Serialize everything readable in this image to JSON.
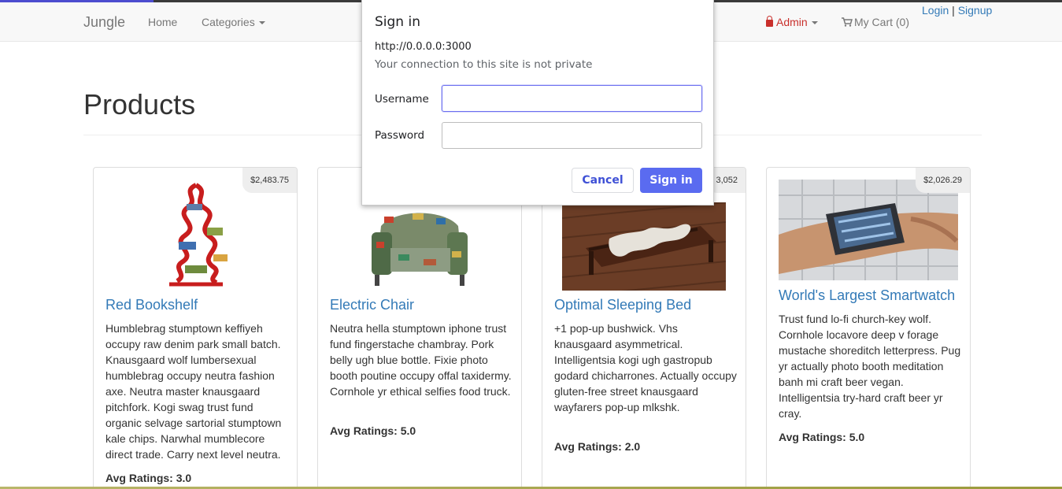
{
  "navbar": {
    "brand": "Jungle",
    "home": "Home",
    "categories": "Categories",
    "admin": "Admin",
    "cart": "My Cart (0)",
    "login": "Login",
    "separator": "|",
    "signup": "Signup"
  },
  "page": {
    "title": "Products"
  },
  "products": [
    {
      "name": "Red Bookshelf",
      "price": "$2,483.75",
      "description": "Humblebrag stumptown keffiyeh occupy raw denim park small batch. Knausgaard wolf lumbersexual humblebrag occupy neutra fashion axe. Neutra master knausgaard pitchfork. Kogi swag trust fund organic selvage sartorial stumptown kale chips. Narwhal mumblecore direct trade. Carry next level neutra.",
      "ratings_label": "Avg Ratings:",
      "rating": "3.0"
    },
    {
      "name": "Electric Chair",
      "price": "",
      "description": "Neutra hella stumptown iphone trust fund fingerstache chambray. Pork belly ugh blue bottle. Fixie photo booth poutine occupy offal taxidermy. Cornhole yr ethical selfies food truck.",
      "ratings_label": "Avg Ratings:",
      "rating": "5.0"
    },
    {
      "name": "Optimal Sleeping Bed",
      "price": "3,052",
      "description": "+1 pop-up bushwick. Vhs knausgaard asymmetrical. Intelligentsia kogi ugh gastropub godard chicharrones. Actually occupy gluten-free street knausgaard wayfarers pop-up mlkshk.",
      "ratings_label": "Avg Ratings:",
      "rating": "2.0"
    },
    {
      "name": "World's Largest Smartwatch",
      "price": "$2,026.29",
      "description": "Trust fund lo-fi church-key wolf. Cornhole locavore deep v forage mustache shoreditch letterpress. Pug yr actually photo booth meditation banh mi craft beer vegan. Intelligentsia try-hard craft beer yr cray.",
      "ratings_label": "Avg Ratings:",
      "rating": "5.0"
    }
  ],
  "dialog": {
    "title": "Sign in",
    "url": "http://0.0.0.0:3000",
    "note": "Your connection to this site is not private",
    "username_label": "Username",
    "username_value": "",
    "password_label": "Password",
    "password_value": "",
    "cancel": "Cancel",
    "sign_in": "Sign in"
  },
  "colors": {
    "link": "#337ab7",
    "admin": "#c9302c",
    "dialog_primary": "#5a6bf0"
  },
  "icons": [
    "lock-icon",
    "cart-icon",
    "chevron-down-icon"
  ]
}
